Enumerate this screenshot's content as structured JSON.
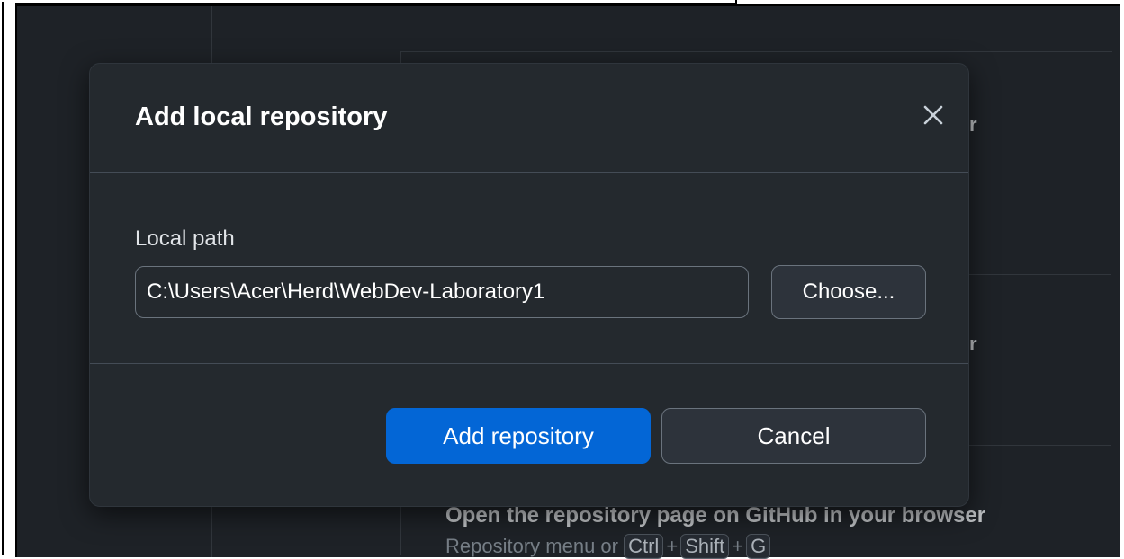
{
  "background": {
    "row1_partial": "r",
    "row2_partial": "r",
    "row3": {
      "title": "Open the repository page on GitHub in your browser",
      "hint_prefix": "Repository menu or",
      "keys": [
        "Ctrl",
        "Shift",
        "G"
      ],
      "plus": "+"
    }
  },
  "dialog": {
    "title": "Add local repository",
    "close_icon": "close-icon",
    "local_path_label": "Local path",
    "local_path_value": "C:\\Users\\Acer\\Herd\\WebDev-Laboratory1",
    "choose_label": "Choose...",
    "add_label": "Add repository",
    "cancel_label": "Cancel"
  },
  "colors": {
    "background": "#24292e",
    "primary": "#0366d6",
    "border": "#6a737d"
  }
}
